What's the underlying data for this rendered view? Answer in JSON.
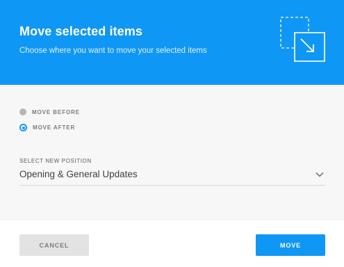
{
  "dialog": {
    "title": "Move selected items",
    "subtitle": "Choose where you want to move your selected items",
    "header_icon": "move-to-corner-icon"
  },
  "options": {
    "before_label": "MOVE BEFORE",
    "after_label": "MOVE AFTER",
    "selected": "after"
  },
  "position": {
    "label": "SELECT NEW POSITION",
    "value": "Opening & General Updates"
  },
  "footer": {
    "cancel_label": "CANCEL",
    "move_label": "MOVE"
  },
  "colors": {
    "accent": "#0f97f5",
    "body_background": "#f7f7f7",
    "cancel_background": "#e3e3e3"
  }
}
